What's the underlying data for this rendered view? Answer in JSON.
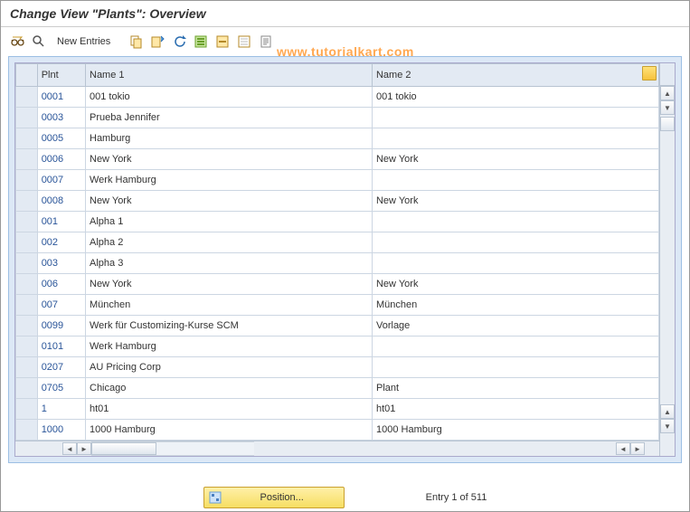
{
  "title": "Change View \"Plants\": Overview",
  "watermark": "www.tutorialkart.com",
  "toolbar": {
    "new_entries_label": "New Entries"
  },
  "table": {
    "headers": {
      "plnt": "Plnt",
      "name1": "Name 1",
      "name2": "Name 2"
    },
    "rows": [
      {
        "plnt": "0001",
        "name1": "001 tokio",
        "name2": "001 tokio"
      },
      {
        "plnt": "0003",
        "name1": "Prueba Jennifer",
        "name2": ""
      },
      {
        "plnt": "0005",
        "name1": "Hamburg",
        "name2": ""
      },
      {
        "plnt": "0006",
        "name1": "New York",
        "name2": "New York"
      },
      {
        "plnt": "0007",
        "name1": "Werk Hamburg",
        "name2": ""
      },
      {
        "plnt": "0008",
        "name1": "New York",
        "name2": "New York"
      },
      {
        "plnt": "001",
        "name1": "Alpha 1",
        "name2": ""
      },
      {
        "plnt": "002",
        "name1": "Alpha 2",
        "name2": ""
      },
      {
        "plnt": "003",
        "name1": "Alpha 3",
        "name2": ""
      },
      {
        "plnt": "006",
        "name1": "New York",
        "name2": "New York"
      },
      {
        "plnt": "007",
        "name1": "München",
        "name2": "München"
      },
      {
        "plnt": "0099",
        "name1": "Werk für Customizing-Kurse SCM",
        "name2": "Vorlage"
      },
      {
        "plnt": "0101",
        "name1": "Werk Hamburg",
        "name2": ""
      },
      {
        "plnt": "0207",
        "name1": "AU Pricing Corp",
        "name2": ""
      },
      {
        "plnt": "0705",
        "name1": "Chicago",
        "name2": "Plant"
      },
      {
        "plnt": "1",
        "name1": "ht01",
        "name2": "ht01"
      },
      {
        "plnt": "1000",
        "name1": "1000 Hamburg",
        "name2": "1000 Hamburg"
      }
    ]
  },
  "footer": {
    "position_label": "Position...",
    "entry_text": "Entry 1 of 511"
  }
}
